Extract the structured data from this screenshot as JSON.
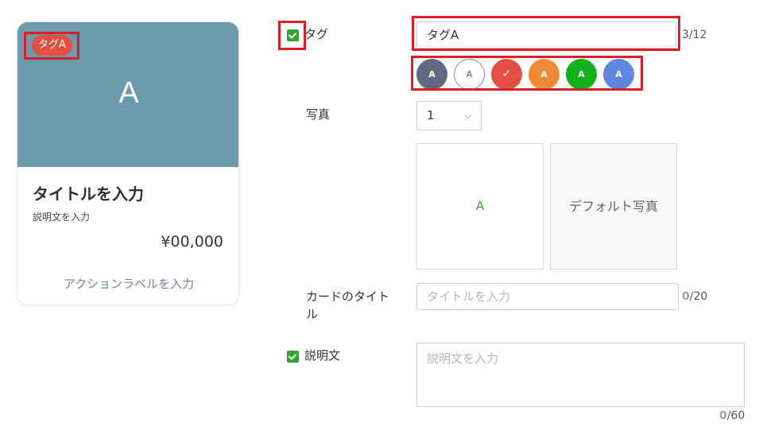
{
  "preview": {
    "tag": "タグA",
    "image_letter": "A",
    "image_color": "#6b9aab",
    "title": "タイトルを入力",
    "description": "説明文を入力",
    "price": "¥00,000",
    "action_label": "アクションラベルを入力"
  },
  "form": {
    "tag": {
      "label": "タグ",
      "checked": true,
      "value": "タグA",
      "count": "3",
      "max": "/12",
      "colors": [
        {
          "letter": "A",
          "color": "#626a80",
          "selected": false
        },
        {
          "letter": "A",
          "color": "#ffffff",
          "selected": false
        },
        {
          "letter": "✓",
          "color": "#e35042",
          "selected": true
        },
        {
          "letter": "A",
          "color": "#ee8a36",
          "selected": false
        },
        {
          "letter": "A",
          "color": "#10b21b",
          "selected": false
        },
        {
          "letter": "A",
          "color": "#5e86e0",
          "selected": false
        }
      ]
    },
    "photo": {
      "label": "写真",
      "select_value": "1",
      "select_icon": "chevron-down-icon",
      "slot_label": "A",
      "default_label": "デフォルト写真"
    },
    "card_title": {
      "label_line1": "カードのタイト",
      "label_line2": "ル",
      "placeholder": "タイトルを入力",
      "count": "0",
      "max": "/20"
    },
    "description": {
      "label": "説明文",
      "checked": true,
      "placeholder": "説明文を入力",
      "count": "0",
      "max": "/60"
    }
  },
  "highlight_color": "#dc1f26"
}
